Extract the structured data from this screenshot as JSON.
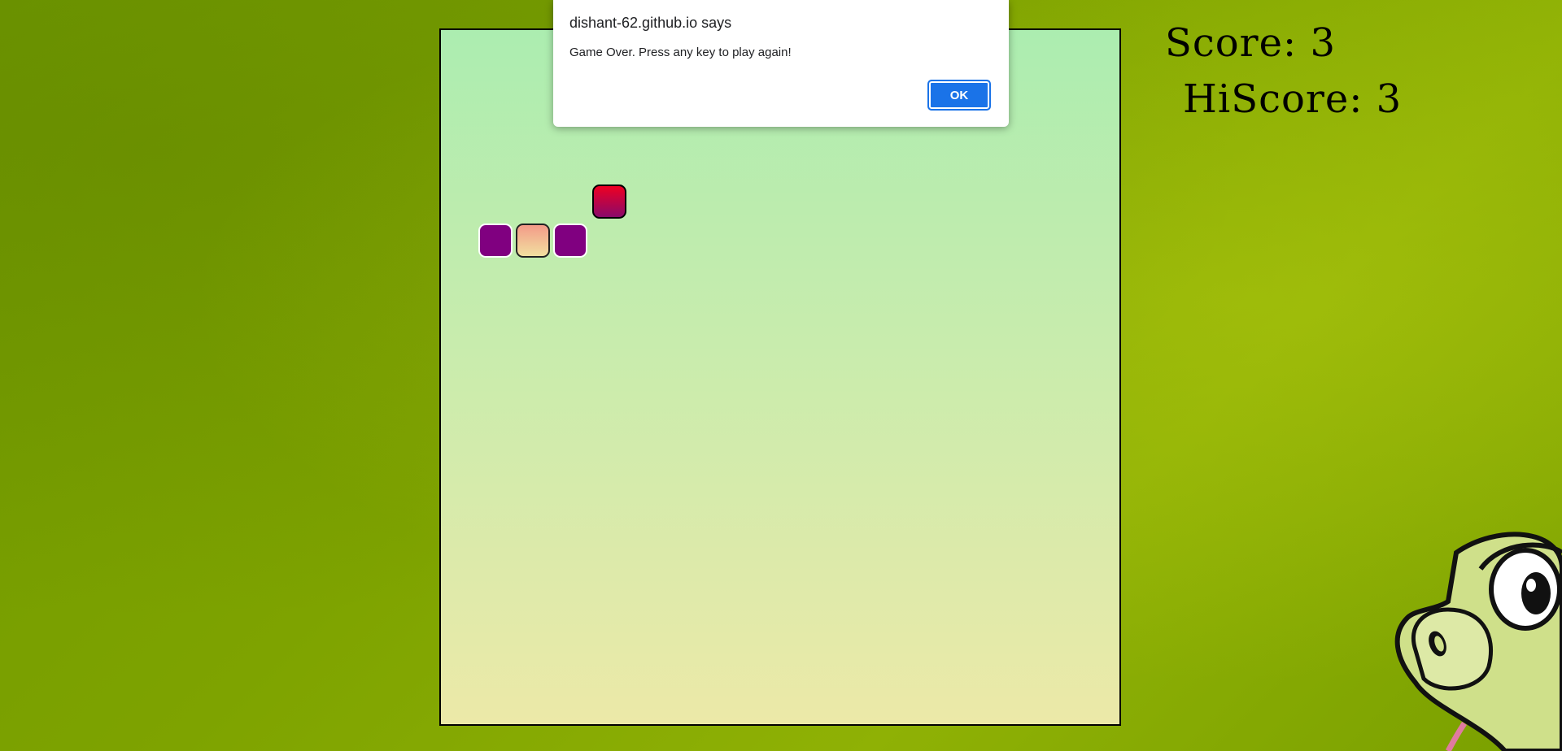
{
  "dialog": {
    "title": "dishant-62.github.io says",
    "message": "Game Over. Press any key to play again!",
    "ok_label": "OK"
  },
  "scoreboard": {
    "score_text": "Score: 3",
    "hiscore_text": "HiScore: 3",
    "score": 3,
    "hiscore": 3
  },
  "board": {
    "snake_segments": 3
  },
  "colors": {
    "background": "#7ea300",
    "snake_body": "#800080",
    "food_top": "#ee0022",
    "food_bottom": "#8a0a6a",
    "ok_button": "#1a73e8"
  },
  "icons": {
    "mascot": "cartoon-snake-icon"
  }
}
